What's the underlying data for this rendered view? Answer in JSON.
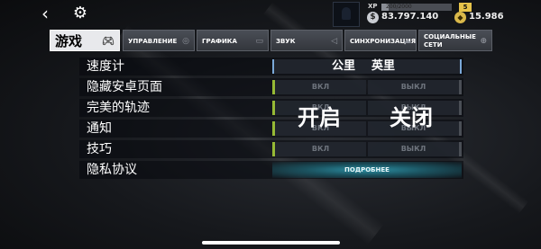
{
  "topbar": {
    "back_icon": "back-arrow-icon",
    "settings_icon": "gear-icon",
    "xp_label": "XP",
    "xp_progress": "200/2000",
    "xp_fraction": 0.1,
    "level": "5",
    "money": "83.797.140",
    "gold": "15.986"
  },
  "tabs": [
    {
      "label": "游戏",
      "icon": "gamepad-icon"
    },
    {
      "label": "УПРАВЛЕНИЕ",
      "icon": "steering-icon"
    },
    {
      "label": "ГРАФИКА",
      "icon": "display-icon"
    },
    {
      "label": "ЗВУК",
      "icon": "speaker-icon"
    },
    {
      "label": "СИНХРОНИЗАЦИЯ",
      "icon": "cloud-icon"
    },
    {
      "label": "СОЦИАЛЬНЫЕ СЕТИ",
      "icon": "globe-icon"
    }
  ],
  "settings": {
    "speedometer": {
      "label": "速度计",
      "opt1": "公里",
      "opt2": "英里"
    },
    "hide_android": {
      "label": "隐藏安卓页面",
      "on": "ВКЛ",
      "off": "ВЫКЛ"
    },
    "perfect_track": {
      "label": "完美的轨迹",
      "on": "ВКЛ",
      "off": "ВЫКЛ"
    },
    "notifications": {
      "label": "通知",
      "on": "ВКЛ",
      "off": "ВЫКЛ"
    },
    "tips": {
      "label": "技巧",
      "on": "ВКЛ",
      "off": "ВЫКЛ"
    },
    "privacy": {
      "label": "隐私协议",
      "button": "ПОДРОБНЕЕ"
    }
  },
  "overlay": {
    "on_text": "开启",
    "off_text": "关闭"
  },
  "colors": {
    "toggle_on": "#96b935",
    "unit_accent": "#7aa8d8",
    "privacy_button": "#2c8fa3",
    "level_badge": "#e6c34a"
  }
}
